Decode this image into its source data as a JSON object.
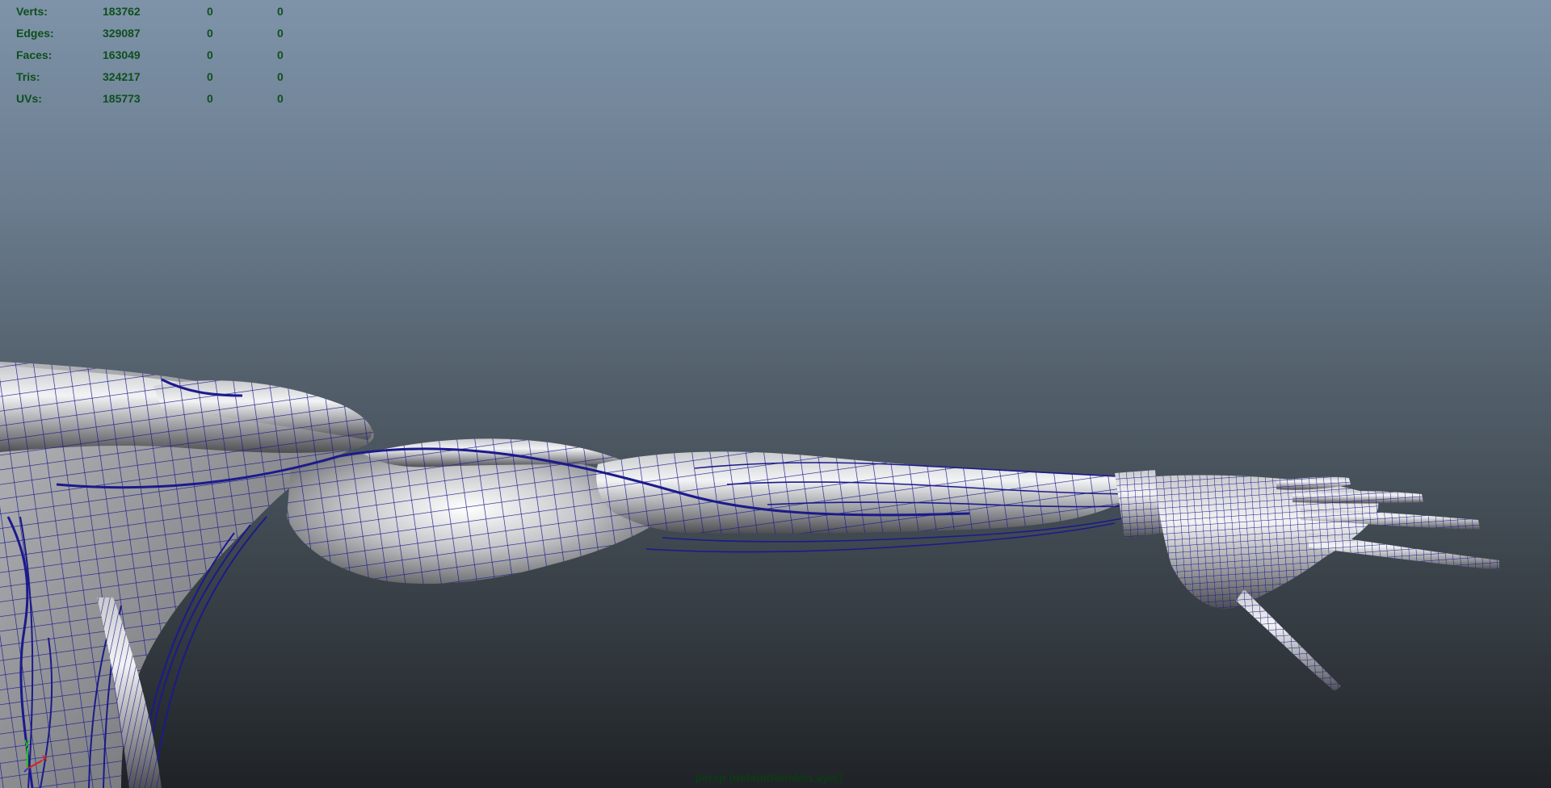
{
  "viewport": {
    "camera_label": "persp (defaultRenderLayer)",
    "background_top_color": "#7e93a9",
    "background_bottom_color": "#1f2327",
    "wireframe_color": "#1b1a8c"
  },
  "hud": {
    "stats": [
      {
        "label": "Verts:",
        "total": "183762",
        "selected": "0",
        "components": "0"
      },
      {
        "label": "Edges:",
        "total": "329087",
        "selected": "0",
        "components": "0"
      },
      {
        "label": "Faces:",
        "total": "163049",
        "selected": "0",
        "components": "0"
      },
      {
        "label": "Tris:",
        "total": "324217",
        "selected": "0",
        "components": "0"
      },
      {
        "label": "UVs:",
        "total": "185773",
        "selected": "0",
        "components": "0"
      }
    ]
  },
  "axis": {
    "y_label": "y",
    "x_label": "x",
    "y_color": "#21c21d",
    "x_color": "#d42020"
  }
}
